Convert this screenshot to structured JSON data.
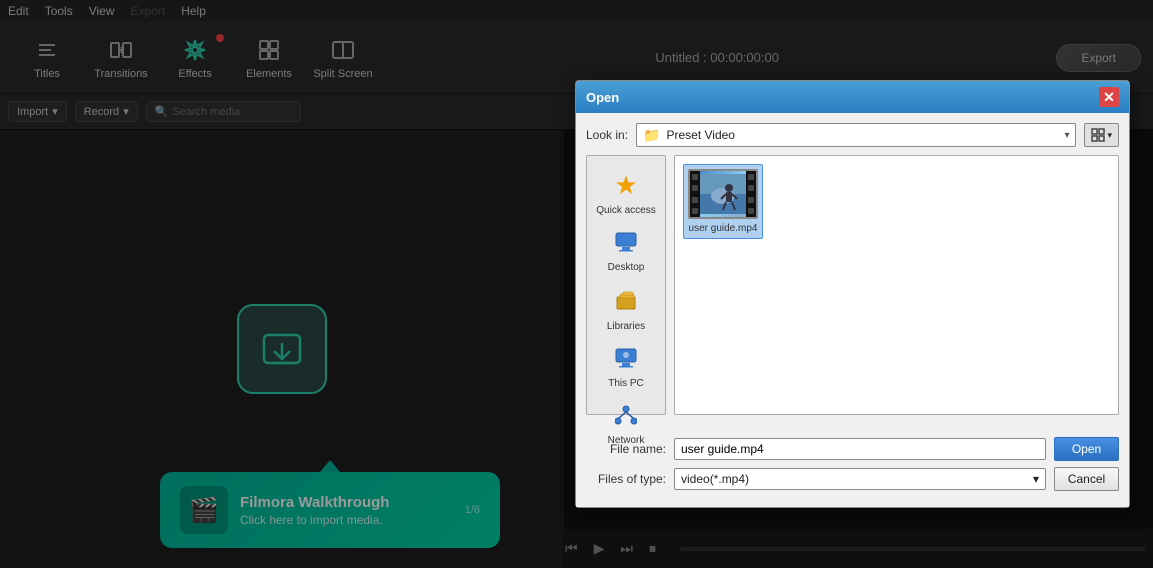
{
  "app": {
    "title": "Untitled : 00:00:00:00"
  },
  "menu": {
    "items": [
      "Edit",
      "Tools",
      "View",
      "Export",
      "Help"
    ]
  },
  "toolbar": {
    "items": [
      {
        "id": "titles",
        "label": "Titles",
        "icon": "T"
      },
      {
        "id": "transitions",
        "label": "Transitions",
        "icon": "⇄"
      },
      {
        "id": "effects",
        "label": "Effects",
        "icon": "✦",
        "hasNotif": true
      },
      {
        "id": "elements",
        "label": "Elements",
        "icon": "⬚"
      },
      {
        "id": "split-screen",
        "label": "Split Screen",
        "icon": "⊞"
      }
    ],
    "export_label": "Export"
  },
  "secondary_toolbar": {
    "import_label": "Import",
    "record_label": "Record",
    "search_placeholder": "Search media"
  },
  "walkthrough": {
    "title": "Filmora Walkthrough",
    "description": "Click here to import media.",
    "counter": "1/6"
  },
  "dialog": {
    "title": "Open",
    "close_icon": "✕",
    "look_in_label": "Look in:",
    "look_in_value": "Preset Video",
    "sidebar_items": [
      {
        "id": "quick-access",
        "label": "Quick access",
        "icon_type": "star"
      },
      {
        "id": "desktop",
        "label": "Desktop",
        "icon_type": "desktop"
      },
      {
        "id": "libraries",
        "label": "Libraries",
        "icon_type": "libraries"
      },
      {
        "id": "this-pc",
        "label": "This PC",
        "icon_type": "pc"
      },
      {
        "id": "network",
        "label": "Network",
        "icon_type": "network"
      }
    ],
    "files": [
      {
        "id": "user-guide",
        "name": "user guide.mp4",
        "selected": true
      }
    ],
    "file_name_label": "File name:",
    "file_name_value": "user guide.mp4",
    "file_type_label": "Files of type:",
    "file_type_value": "video(*.mp4)",
    "open_btn_label": "Open",
    "cancel_btn_label": "Cancel"
  }
}
